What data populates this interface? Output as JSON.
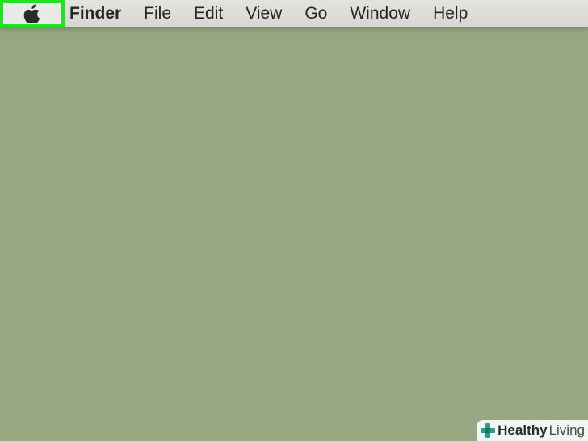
{
  "menubar": {
    "apple_icon": "apple-logo-icon",
    "app_name": "Finder",
    "items": [
      {
        "label": "File"
      },
      {
        "label": "Edit"
      },
      {
        "label": "View"
      },
      {
        "label": "Go"
      },
      {
        "label": "Window"
      },
      {
        "label": "Help"
      }
    ]
  },
  "watermark": {
    "logo_icon": "plus-cross-icon",
    "word1": "Healthy",
    "word2": "Living"
  },
  "colors": {
    "desktop": "#98a882",
    "menubar": "#dcddd9",
    "highlight": "#22e022",
    "logo_teal": "#2a9d8f"
  }
}
